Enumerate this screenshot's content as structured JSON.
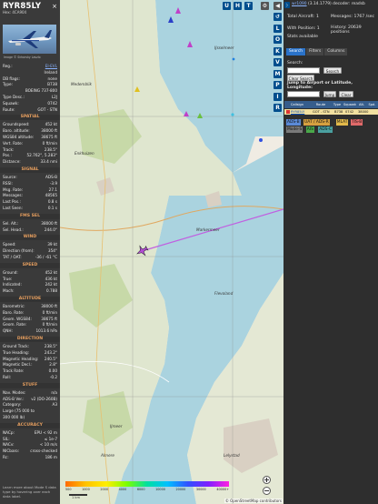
{
  "left": {
    "callsign": "RYR85LY",
    "hex": "Hex: 4CA904",
    "close_label": "×",
    "photo_credit": "Image © Sirkorsky Laszlo",
    "info_rows": [
      {
        "k": "Reg.:",
        "v": "EI-EVL",
        "link": true
      },
      {
        "k": "",
        "v": "Ireland"
      },
      {
        "k": "DB flags:",
        "v": "none"
      },
      {
        "k": "Type:",
        "v": "B738"
      },
      {
        "k": "",
        "v": "BOEING 737-800"
      },
      {
        "k": "Type Desc.:",
        "v": "L2J"
      },
      {
        "k": "Squawk:",
        "v": "0742"
      },
      {
        "k": "Route:",
        "v": "GOT - STN"
      }
    ],
    "spatial_title": "SPATIAL",
    "spatial_rows": [
      {
        "k": "Groundspeed:",
        "v": "452 kt"
      },
      {
        "k": "Baro. altitude:",
        "v": "38000 ft"
      },
      {
        "k": "WGS84 altitude:",
        "v": "38675 ft"
      },
      {
        "k": "Vert. Rate:",
        "v": "0 ft/min"
      },
      {
        "k": "Track:",
        "v": "238.5°"
      },
      {
        "k": "Pos.:",
        "v": "52.762°, 5.283°"
      },
      {
        "k": "Distance:",
        "v": "33.4 nmi"
      }
    ],
    "signal_title": "SIGNAL",
    "signal_rows": [
      {
        "k": "Source:",
        "v": "ADS-B"
      },
      {
        "k": "RSSI:",
        "v": "-3.9"
      },
      {
        "k": "Msg. Rate:",
        "v": "27.1"
      },
      {
        "k": "Messages:",
        "v": "48565"
      },
      {
        "k": "Last Pos.:",
        "v": "0.8 s"
      },
      {
        "k": "Last Seen:",
        "v": "0.1 s"
      }
    ],
    "fms_title": "FMS SEL",
    "fms_rows": [
      {
        "k": "Sel. Alt.:",
        "v": "38000 ft"
      },
      {
        "k": "Sel. Head.:",
        "v": "244.0°"
      }
    ],
    "wind_title": "WIND",
    "wind_rows": [
      {
        "k": "Speed:",
        "v": "39 kt"
      },
      {
        "k": "Direction (from):",
        "v": "354°"
      },
      {
        "k": "TAT / OAT:",
        "v": "-36 / -61 °C"
      }
    ],
    "speed_title": "SPEED",
    "speed_rows": [
      {
        "k": "Ground:",
        "v": "452 kt"
      },
      {
        "k": "True:",
        "v": "436 kt"
      },
      {
        "k": "Indicated:",
        "v": "242 kt"
      },
      {
        "k": "Mach:",
        "v": "0.788"
      }
    ],
    "altitude_title": "ALTITUDE",
    "altitude_rows": [
      {
        "k": "Barometric:",
        "v": "38000 ft"
      },
      {
        "k": "Baro. Rate:",
        "v": "0 ft/min"
      },
      {
        "k": "Geom. WGS84:",
        "v": "38675 ft"
      },
      {
        "k": "Geom. Rate:",
        "v": "0 ft/min"
      },
      {
        "k": "QNH:",
        "v": "1013.6 hPa"
      }
    ],
    "direction_title": "DIRECTION",
    "direction_rows": [
      {
        "k": "Ground Track:",
        "v": "238.5°"
      },
      {
        "k": "True Heading:",
        "v": "243.2°"
      },
      {
        "k": "Magnetic Heading:",
        "v": "240.5°"
      },
      {
        "k": "Magnetic Decl.:",
        "v": "2.8°"
      },
      {
        "k": "Track Rate:",
        "v": "0.00"
      },
      {
        "k": "Roll:",
        "v": "-0.2"
      }
    ],
    "stuff_title": "STUFF",
    "stuff_rows": [
      {
        "k": "Nav. Modes:",
        "v": "n/a"
      },
      {
        "k": "ADS-B Ver.:",
        "v": "v2 (DO-260B)"
      },
      {
        "k": "Category:",
        "v": "A3"
      },
      {
        "k": "Large (75 000 to",
        "v": ""
      },
      {
        "k": "300 000 lb)",
        "v": ""
      }
    ],
    "accuracy_title": "ACCURACY",
    "accuracy_rows": [
      {
        "k": "NACp:",
        "v": "EPU < 92 m"
      },
      {
        "k": "SIL:",
        "v": "≤ 1e-7"
      },
      {
        "k": "NACv:",
        "v": "< 10 m/s"
      },
      {
        "k": "NICbaro:",
        "v": "cross-checked"
      },
      {
        "k": "Rc:",
        "v": "186 m"
      }
    ],
    "footer_note": "Learn more about Mode S data type by hovering over each data label."
  },
  "map": {
    "top_buttons": [
      "U",
      "H",
      "T"
    ],
    "labels": {
      "medemblik": "Medemblik",
      "enkhuizen": "Enkhuizen",
      "markermeer": "Markermeer",
      "ijsselmeer": "IJsselmeer",
      "flevoland_n": "Flevoland",
      "lelystad": "Lelystad",
      "almere": "Almere",
      "ijmeer": "IJmeer"
    },
    "scale_label": "1 km",
    "attribution": "© OpenStreetMap contributors",
    "altitude_scale": [
      "500",
      "1000",
      "2000",
      "4000",
      "6000",
      "10000",
      "20000",
      "30000",
      "40000+"
    ],
    "zoom_in": "+",
    "zoom_out": "−"
  },
  "tools": [
    "↺",
    "L",
    "O",
    "K",
    "V",
    "M",
    "P",
    "I",
    "R"
  ],
  "right": {
    "toggle_label": "⟩",
    "header_link": "wr1090",
    "header_version": "(3.14.1779) decoder: readsb",
    "total_aircraft": "Total Aircraft: 1",
    "with_position": "With Position: 1",
    "stats": "Stats available",
    "messages": "Messages: 1767 /sec",
    "history": "History: 20639 positions",
    "tabs": [
      "Search",
      "Filters",
      "Columns"
    ],
    "search_label": "Search:",
    "search_button": "Search",
    "clear_search": "Clear Search",
    "jump_label": "Jump to Airport or Latitude, Longitude:",
    "jump_button": "Jump",
    "clear_button": "Clear",
    "columns": [
      "Callsign",
      "Route",
      "Type",
      "Squawk",
      "Alt.",
      "Spd."
    ],
    "row": {
      "callsign": "RYR85LY",
      "route": "GOT - STN",
      "type": "B738",
      "squawk": "0742",
      "alt": "38000"
    },
    "legend": [
      {
        "label": "ADS-B",
        "color": "#5b8ad6"
      },
      {
        "label": "UAT / ADS-R",
        "color": "#d6a040"
      },
      {
        "label": "MLAT",
        "color": "#e2b94a"
      },
      {
        "label": "TIS-B",
        "color": "#e06a6a"
      },
      {
        "label": "Mode-S",
        "color": "#7a7a7a"
      },
      {
        "label": "AIS",
        "color": "#4aa84a"
      },
      {
        "label": "ADS-C",
        "color": "#4aa0a0"
      }
    ]
  }
}
